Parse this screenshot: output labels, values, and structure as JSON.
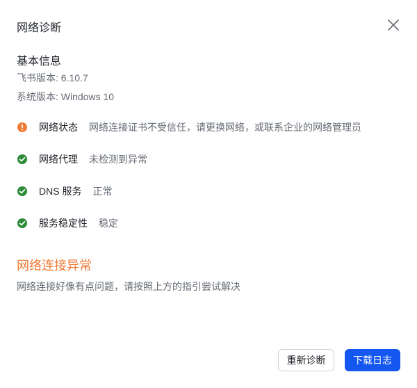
{
  "dialog": {
    "title": "网络诊断",
    "close_icon": "close-icon"
  },
  "basic_info": {
    "heading": "基本信息",
    "feishu_version_label": "飞书版本: ",
    "feishu_version": "6.10.7",
    "system_version_label": "系统版本: ",
    "system_version": "Windows 10"
  },
  "checks": [
    {
      "name": "网络状态",
      "message": "网络连接证书不受信任，请更换网络，或联系企业的网络管理员",
      "status": "warning",
      "icon": "warning-icon",
      "color": "#f07a34"
    },
    {
      "name": "网络代理",
      "message": "未检测到异常",
      "status": "ok",
      "icon": "check-circle-icon",
      "color": "#2e8b3a"
    },
    {
      "name": "DNS 服务",
      "message": "正常",
      "status": "ok",
      "icon": "check-circle-icon",
      "color": "#2e8b3a"
    },
    {
      "name": "服务稳定性",
      "message": "稳定",
      "status": "ok",
      "icon": "check-circle-icon",
      "color": "#2e8b3a"
    }
  ],
  "result": {
    "title": "网络连接异常",
    "description": "网络连接好像有点问题，请按照上方的指引尝试解决",
    "color": "#f07a34"
  },
  "actions": {
    "rediagnose_label": "重新诊断",
    "download_log_label": "下载日志",
    "primary_color": "#1456f0"
  }
}
